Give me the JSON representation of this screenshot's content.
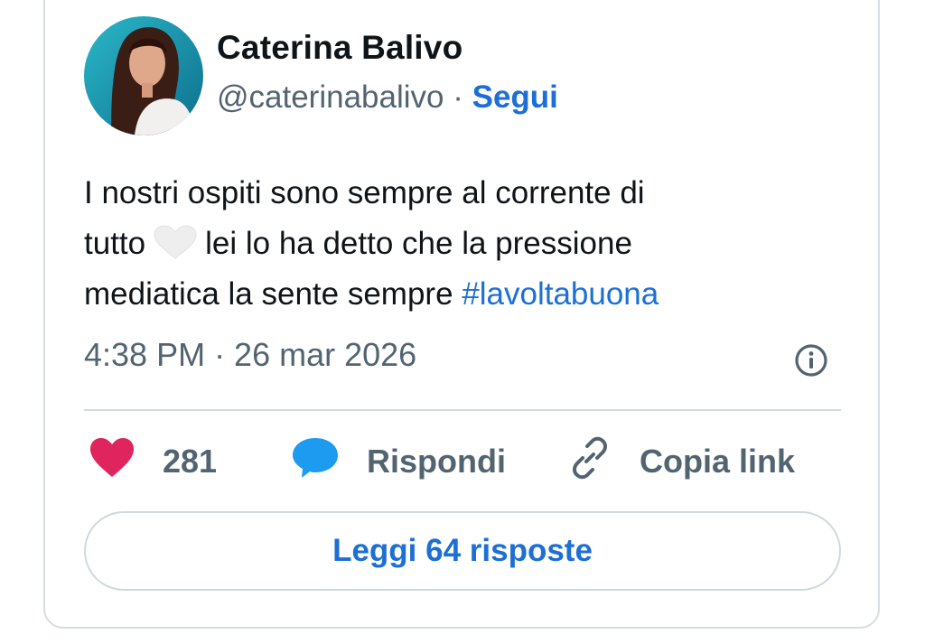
{
  "author": {
    "display_name": "Caterina Balivo",
    "handle": "@caterinabalivo",
    "separator": " · ",
    "follow_label": "Segui"
  },
  "tweet": {
    "line1": "I nostri ospiti sono sempre al corrente di",
    "line2_before": "tutto",
    "line2_after": "lei lo ha detto che la pressione",
    "line3_text": "mediatica la sente sempre ",
    "hashtag": "#lavoltabuona",
    "emoji": "white-heart-icon"
  },
  "timestamp": "4:38 PM · 26 mar 2026",
  "actions": {
    "likes_count": "281",
    "reply_label": "Rispondi",
    "copy_link_label": "Copia link"
  },
  "read_replies_label": "Leggi 64 risposte",
  "colors": {
    "link_blue": "#1d6fd6",
    "like_pink": "#e0245e",
    "reply_blue": "#1d9bf0",
    "secondary_text": "#536471"
  }
}
